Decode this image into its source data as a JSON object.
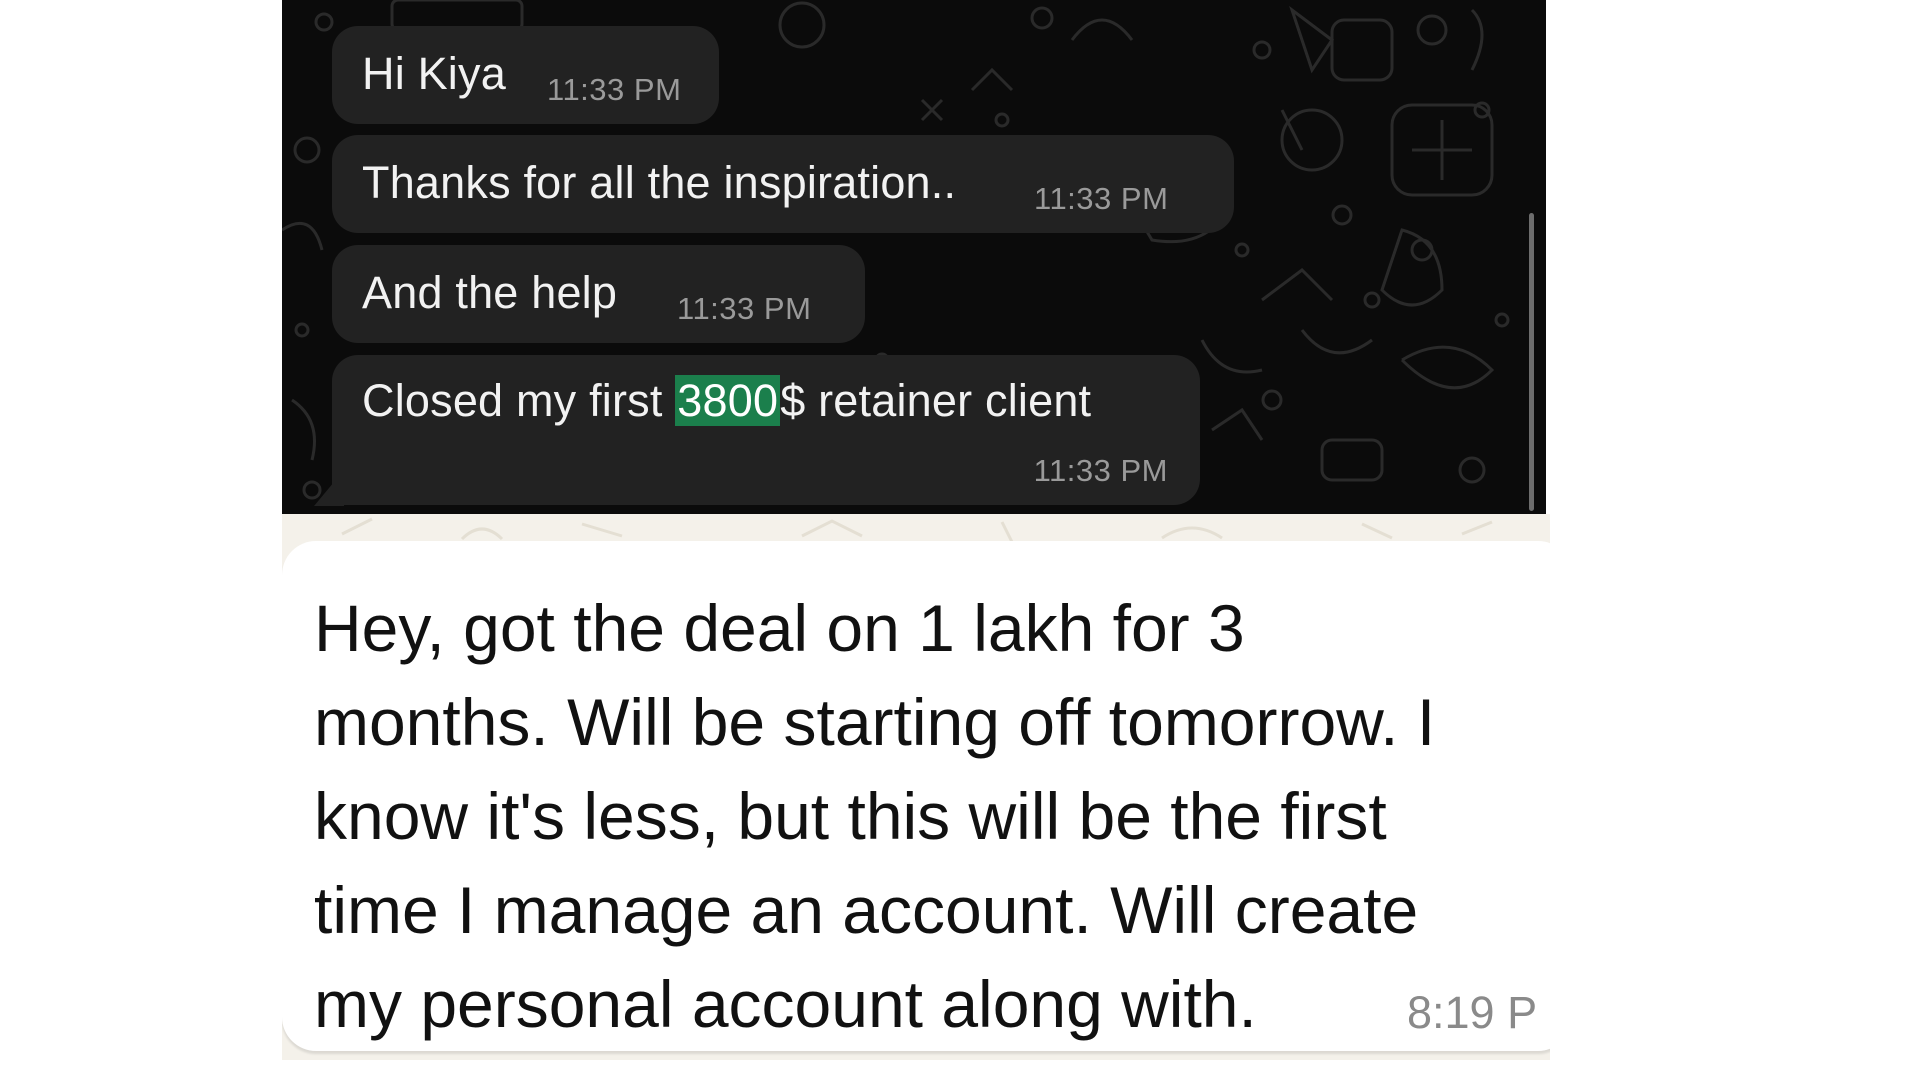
{
  "top_chat": {
    "theme": "dark",
    "bubble_color": "#222222",
    "background_color": "#0b0b0b",
    "highlight_color": "#1b7f4c",
    "messages": [
      {
        "text": "Hi Kiya",
        "time": "11:33 PM"
      },
      {
        "text": "Thanks for all the inspiration..",
        "time": "11:33 PM"
      },
      {
        "text": "And the help",
        "time": "11:33 PM"
      },
      {
        "text_before": "Closed my first ",
        "highlighted": "3800",
        "text_after": "$ retainer client",
        "time": "11:33 PM"
      }
    ]
  },
  "bottom_chat": {
    "theme": "light",
    "bubble_color": "#ffffff",
    "background_color": "#f4f1ea",
    "message": {
      "text": "Hey, got the deal on 1 lakh for 3\nmonths. Will be starting off tomorrow. I\nknow it's less, but this will be the first\ntime I manage an account. Will create\nmy personal account along with.",
      "time": "8:19 P"
    }
  }
}
